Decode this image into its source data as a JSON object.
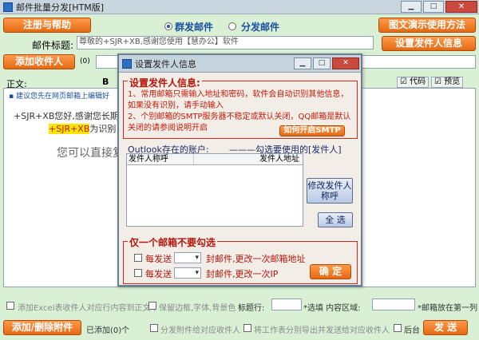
{
  "window": {
    "title": "邮件批量分发[HTM版]"
  },
  "top": {
    "register_help": "注册与帮助",
    "mode_mass": "群发邮件",
    "mode_dispatch": "分发邮件",
    "demo_button": "图文演示使用方法",
    "subject_label": "邮件标题:",
    "subject_value": "尊敬的+SJR+XB,感谢您使用【慧办公】软件",
    "set_sender_button": "设置发件人信息",
    "add_recipient_button": "添加收件人",
    "recipient_count": "(0)"
  },
  "toolbar": {
    "body_label": "正文:",
    "bold": "B",
    "code": "代码",
    "preview": "预览"
  },
  "editor": {
    "tip": "▪ 建议您先在网页邮箱上编辑好",
    "line1": "+SJR+XB您好,感谢您长期",
    "line2_highlight": "+SJR+XB",
    "line2_rest": "为识别",
    "line3": "您可以直接复"
  },
  "dialog": {
    "title": "设置发件人信息",
    "heading": "设置发件人信息:",
    "note1": "1、常用邮箱只需输入地址和密码，软件会自动识别其他信息，如果没有识别，请手动输入",
    "note2": "2、个别邮箱的SMTP服务器不稳定或默认关闭，QQ邮箱是默认关闭的请参阅说明开启",
    "smtp_button": "如何开启SMTP",
    "outlook_label": "Outlook存在的账户:",
    "select_hint": "———勾选要使用的[发件人]",
    "col_name": "发件人称呼",
    "col_addr": "发件人地址",
    "modify_button": "修改发件人称呼",
    "select_all_button": "全 选",
    "single_heading": "仅一个邮箱不要勾选",
    "every_send_1": "每发送",
    "change_addr": "封邮件,更改一次邮箱地址",
    "every_send_2": "每发送",
    "change_ip": "封邮件,更改一次IP",
    "ok_button": "确 定"
  },
  "bottom": {
    "excel_option": "添加Excel表收件人对应行内容到正文 (",
    "keep_border": "保留边框,字体,背景色 )",
    "title_row_label": "标题行:",
    "selected_area": "*选填 内容区域:",
    "recipient_first_col": "*邮箱放在第一列",
    "add_remove_attach": "添加/删除附件",
    "attached_count": "已添加(0)个",
    "dispatch_attach": "分发附件给对应收件人",
    "split_sheet": "将工作表分别导出并发送给对应收件人",
    "background": "后台",
    "send_button": "发 送"
  },
  "colors": {
    "accent_orange": "#e46a14",
    "note_red": "#c41a0a",
    "body_bg": "#d9f0d4"
  }
}
